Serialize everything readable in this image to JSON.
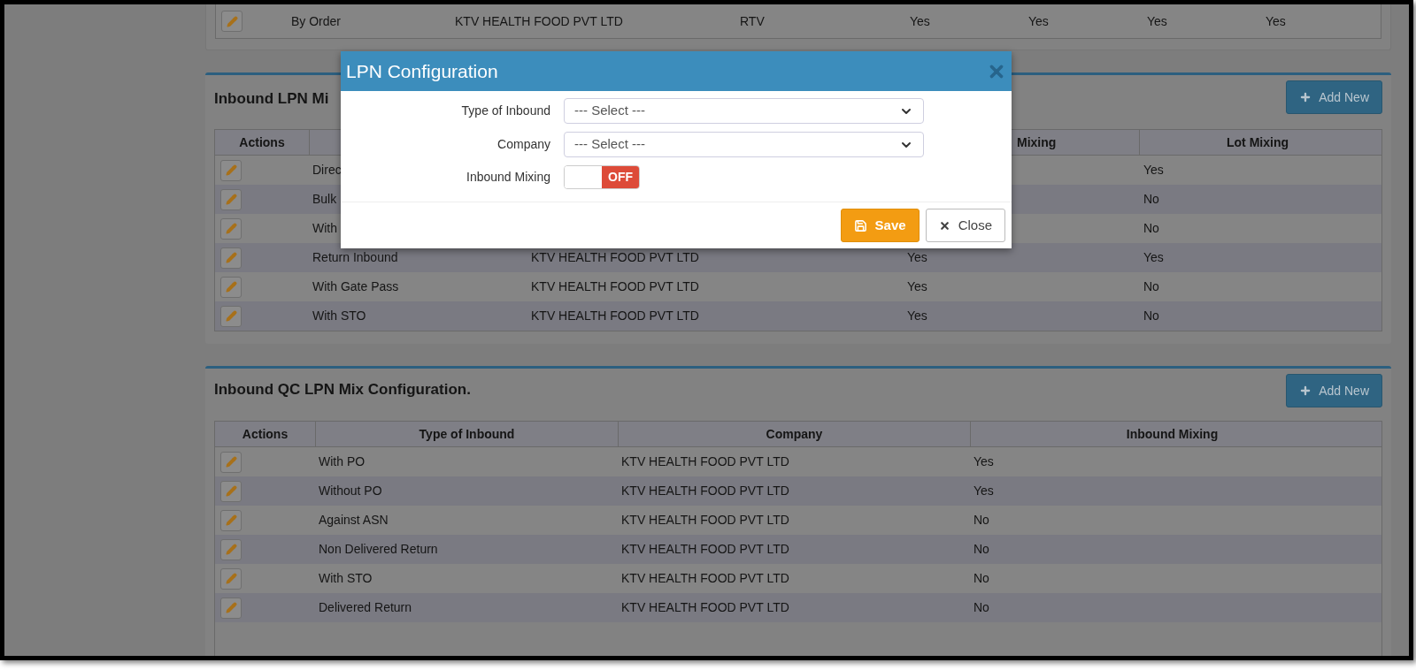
{
  "top_table": {
    "rows": [
      {
        "column_2": "By Order",
        "column_3": "KTV HEALTH FOOD PVT LTD",
        "column_4": "RTV",
        "column_5": "Yes",
        "column_6": "Yes",
        "column_7": "Yes",
        "column_8": "Yes"
      }
    ]
  },
  "lpn_section": {
    "title": "Inbound LPN Mi",
    "add_button": "Add New",
    "header": {
      "column_1": "Actions",
      "column_4": "Mixing",
      "column_5": "Lot Mixing"
    },
    "rows": [
      {
        "column_2": "Direc",
        "column_5": "Yes"
      },
      {
        "column_2": "Bulk",
        "column_5": "No"
      },
      {
        "column_2": "With",
        "column_5": "No"
      },
      {
        "column_2": "Return Inbound",
        "column_3": "KTV HEALTH FOOD PVT LTD",
        "column_4": "Yes",
        "column_5": "Yes"
      },
      {
        "column_2": "With Gate Pass",
        "column_3": "KTV HEALTH FOOD PVT LTD",
        "column_4": "Yes",
        "column_5": "No"
      },
      {
        "column_2": "With STO",
        "column_3": "KTV HEALTH FOOD PVT LTD",
        "column_4": "Yes",
        "column_5": "No"
      }
    ]
  },
  "qc_section": {
    "title": "Inbound QC LPN Mix Configuration.",
    "add_button": "Add New",
    "columns": [
      "Actions",
      "Type of Inbound",
      "Company",
      "Inbound Mixing"
    ],
    "rows": [
      {
        "type": "With PO",
        "company": "KTV HEALTH FOOD PVT LTD",
        "mixing": "Yes"
      },
      {
        "type": "Without PO",
        "company": "KTV HEALTH FOOD PVT LTD",
        "mixing": "Yes"
      },
      {
        "type": "Against ASN",
        "company": "KTV HEALTH FOOD PVT LTD",
        "mixing": "No"
      },
      {
        "type": "Non Delivered Return",
        "company": "KTV HEALTH FOOD PVT LTD",
        "mixing": "No"
      },
      {
        "type": "With STO",
        "company": "KTV HEALTH FOOD PVT LTD",
        "mixing": "No"
      },
      {
        "type": "Delivered Return",
        "company": "KTV HEALTH FOOD PVT LTD",
        "mixing": "No"
      }
    ]
  },
  "modal": {
    "title": "LPN Configuration",
    "fields": [
      {
        "kind": "select",
        "label": "Type of Inbound",
        "value": "--- Select ---"
      },
      {
        "kind": "select",
        "label": "Company",
        "value": "--- Select ---"
      },
      {
        "kind": "toggle",
        "label": "Inbound Mixing",
        "on": false,
        "state_text": "OFF"
      }
    ],
    "buttons": [
      {
        "kind": "primary",
        "label": "Save"
      },
      {
        "kind": "default",
        "label": "Close"
      }
    ]
  }
}
